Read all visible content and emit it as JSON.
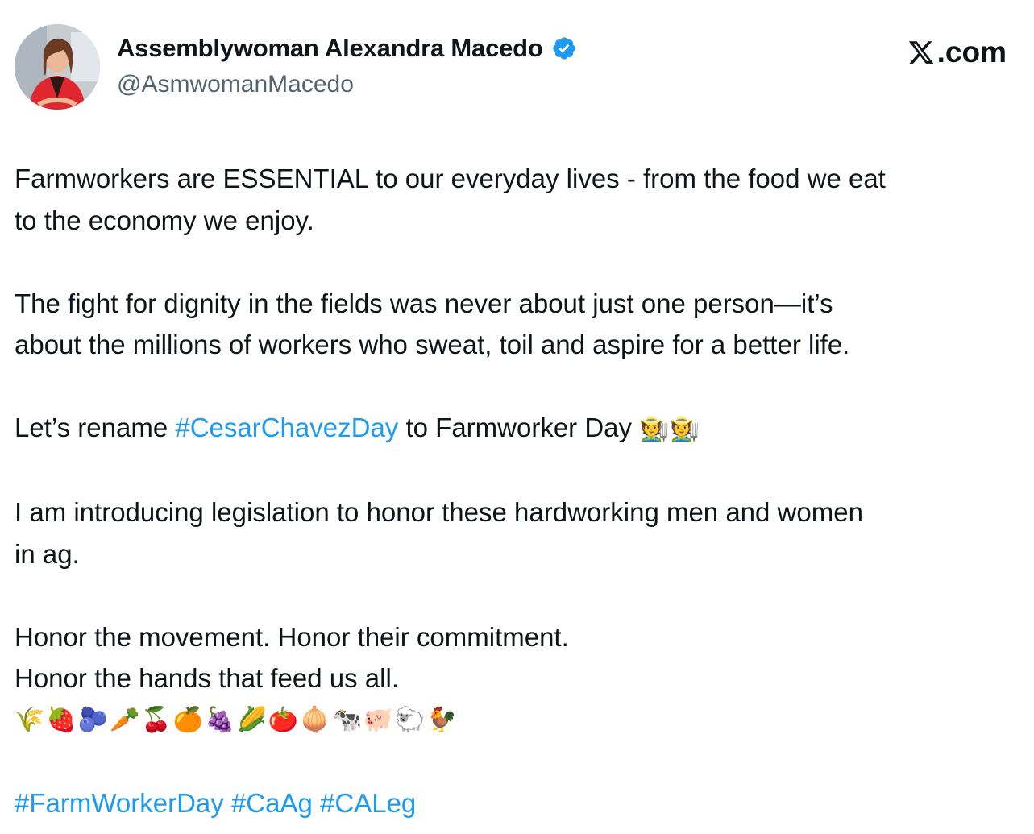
{
  "author": {
    "display_name": "Assemblywoman Alexandra Macedo",
    "handle": "@AsmwomanMacedo",
    "verified": true
  },
  "brand": {
    "label": ".com",
    "icon": "x-logo-icon"
  },
  "colors": {
    "text": "#0f1419",
    "secondary": "#536471",
    "link": "#1d9bf0",
    "verified": "#1d9bf0"
  },
  "tweet": {
    "p1_l1": "Farmworkers are ESSENTIAL to our everyday lives - from the food we eat",
    "p1_l2": "to the economy we enjoy.",
    "p2_l1": "The fight for dignity in the fields was never about just one person—it’s",
    "p2_l2": "about the millions of workers who sweat, toil and aspire for a better life.",
    "p3_before": "Let’s rename ",
    "p3_hashtag": "#CesarChavezDay",
    "p3_after": " to Farmworker Day ",
    "p3_emoji": "🧑‍🌾🧑‍🌾",
    "p4_l1": "I am introducing legislation to honor these hardworking men and women",
    "p4_l2": "in ag.",
    "p5_l1": "Honor the movement. Honor their commitment.",
    "p5_l2": "Honor the hands that feed us all.",
    "p5_emoji": "🌾🍓🫐🥕🍒🍊🍇🌽🍅🧅🐄🐖🐑🐓",
    "hashtags": [
      "#FarmWorkerDay",
      "#CaAg",
      "#CALeg"
    ]
  }
}
